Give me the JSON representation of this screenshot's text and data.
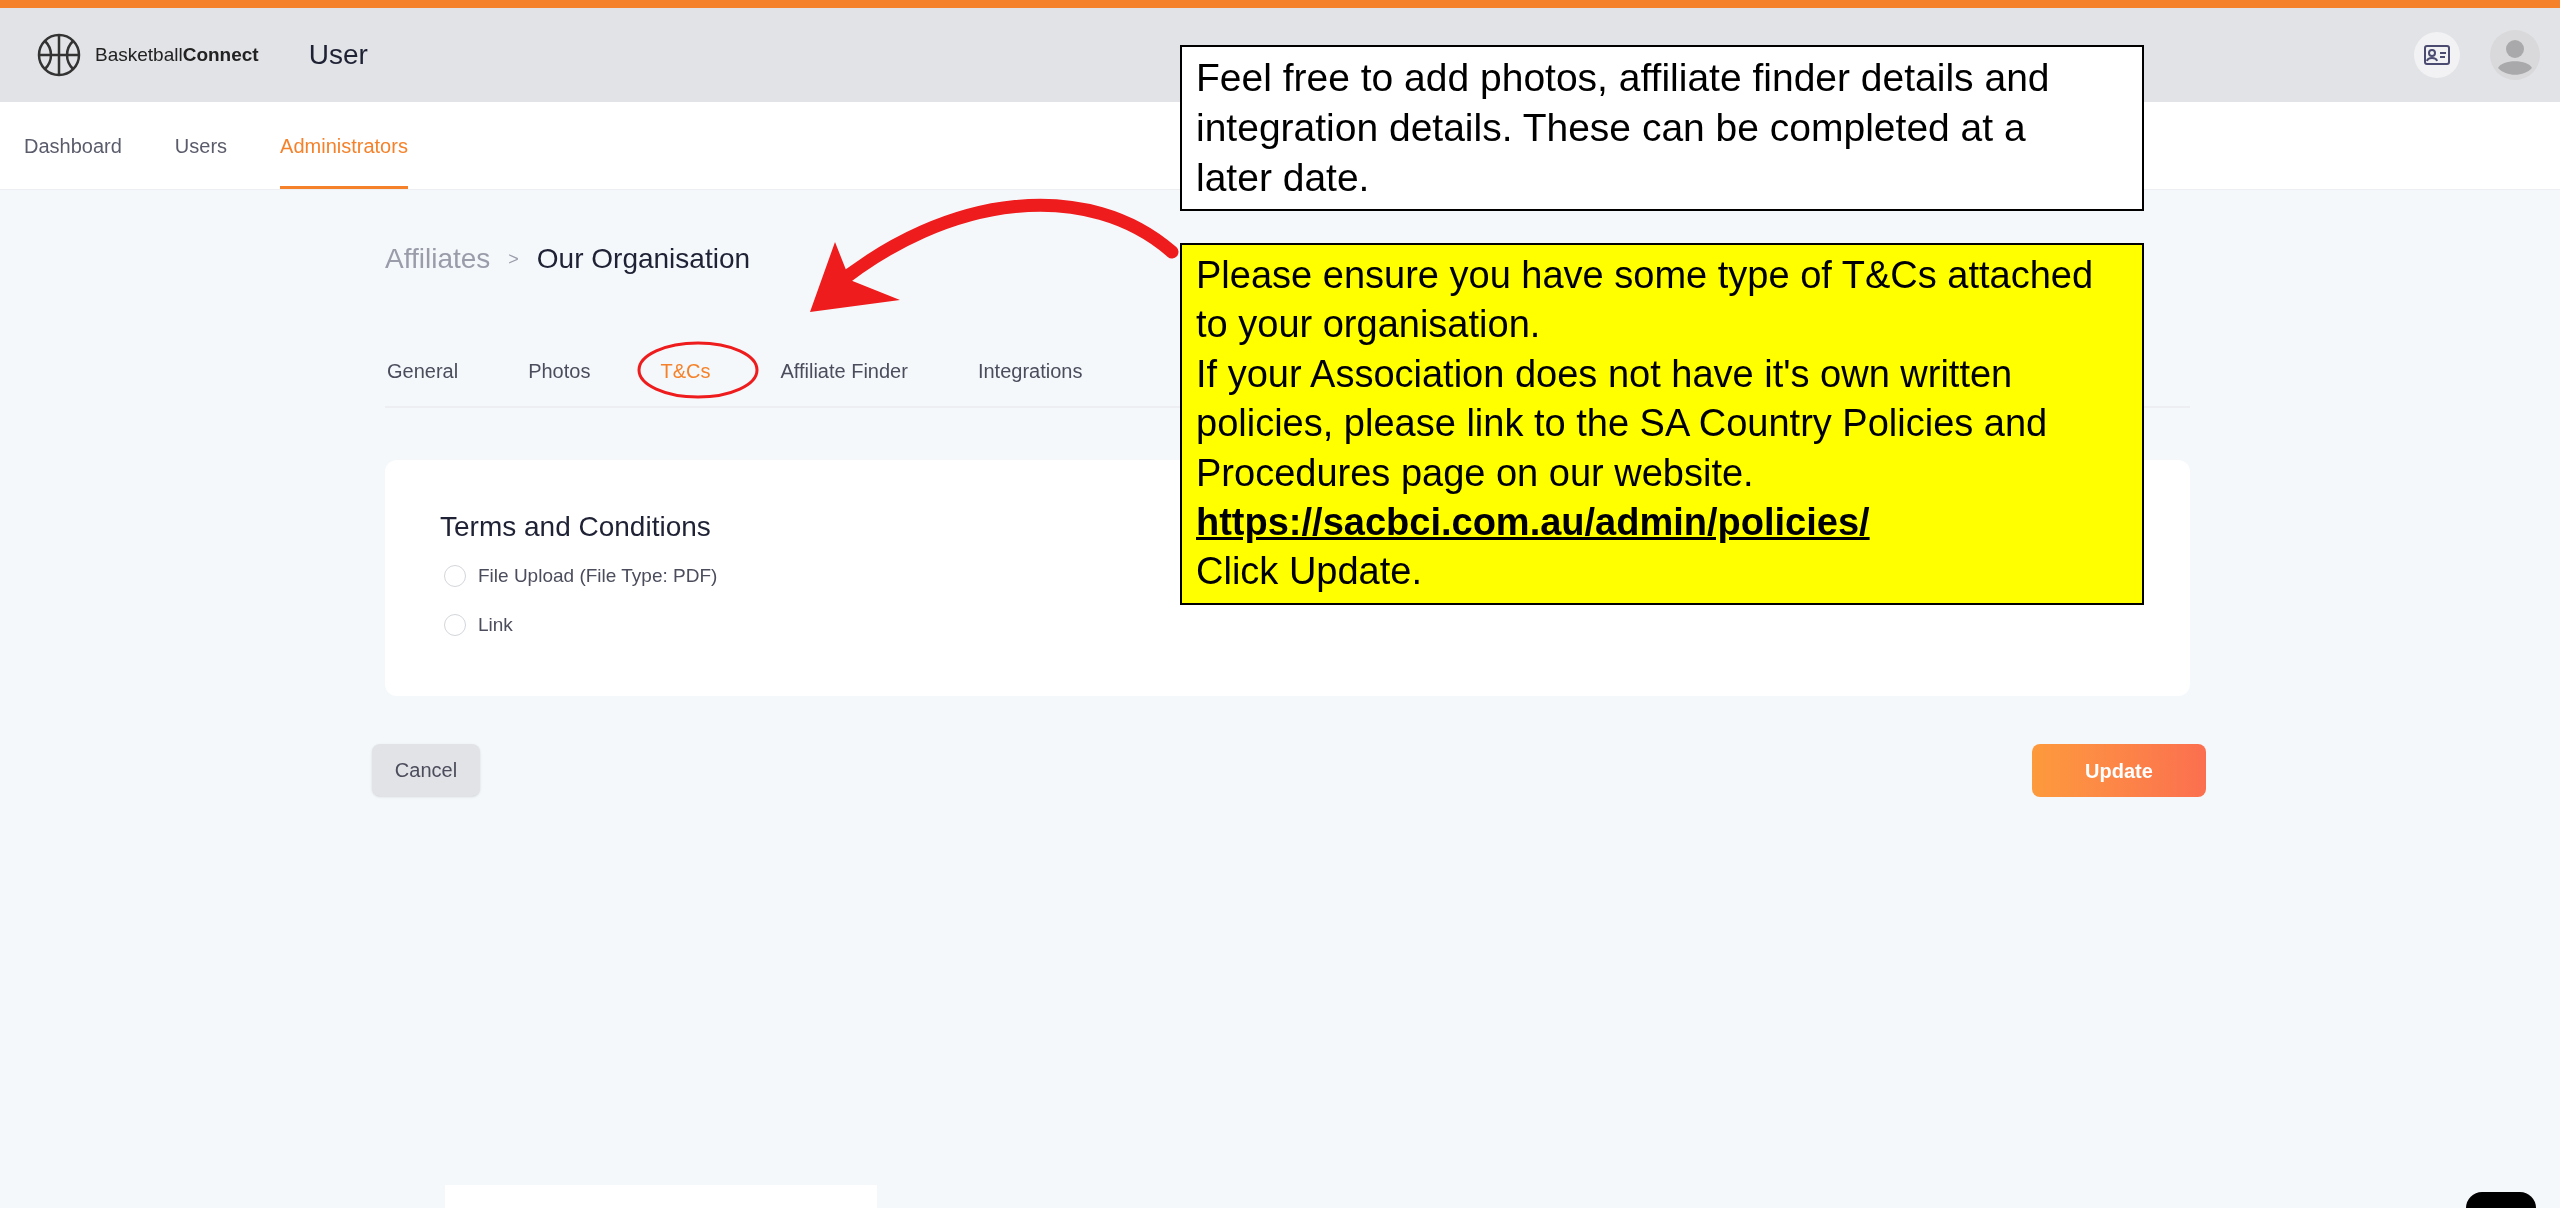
{
  "header": {
    "logo_text": "Basketball**Connect**",
    "title": "User"
  },
  "nav": [
    {
      "label": "Dashboard",
      "selected": false
    },
    {
      "label": "Users",
      "selected": false
    },
    {
      "label": "Administrators",
      "selected": true
    }
  ],
  "breadcrumb": {
    "parent": "Affiliates",
    "separator": ">",
    "current": "Our Organisation"
  },
  "tabs": [
    {
      "label": "General",
      "selected": false
    },
    {
      "label": "Photos",
      "selected": false
    },
    {
      "label": "T&Cs",
      "selected": true
    },
    {
      "label": "Affiliate Finder",
      "selected": false
    },
    {
      "label": "Integrations",
      "selected": false
    }
  ],
  "card": {
    "title": "Terms and Conditions",
    "options": [
      {
        "label": "File Upload (File Type: PDF)",
        "checked": false
      },
      {
        "label": "Link",
        "checked": false
      }
    ]
  },
  "buttons": {
    "cancel": "Cancel",
    "update": "Update"
  },
  "annotations": {
    "note": "Feel free to add photos, affiliate finder details and integration details. These can be completed at a later date.",
    "highlight": {
      "paragraphs": [
        "Please ensure you have some type of T&Cs attached to your organisation.",
        "If your Association does not have it's own written policies, please link to the SA Country Policies and Procedures page on our website."
      ],
      "link": "https://sacbci.com.au/admin/policies/",
      "closing": "Click Update."
    }
  }
}
